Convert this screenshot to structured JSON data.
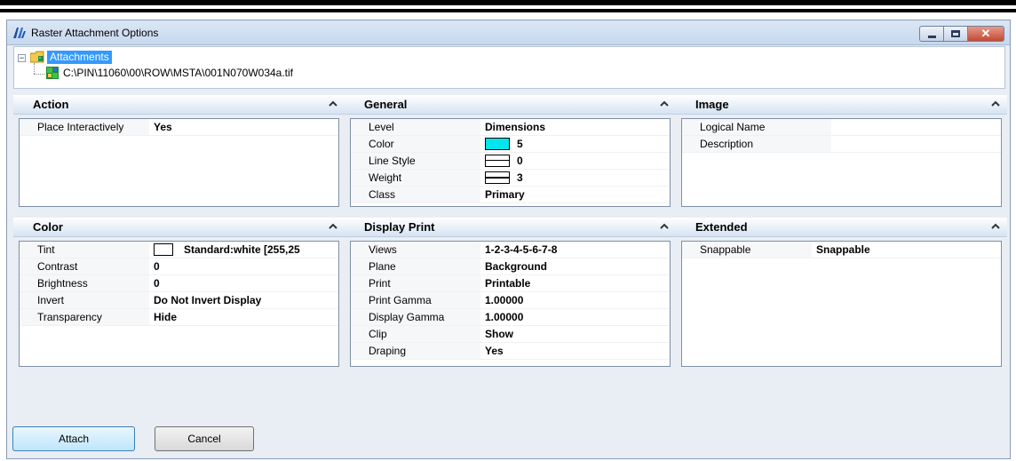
{
  "window": {
    "title": "Raster Attachment Options",
    "close_glyph": "✕"
  },
  "tree": {
    "expander_glyph": "−",
    "root_label": "Attachments",
    "file_path": "C:\\PIN\\11060\\00\\ROW\\MSTA\\001N070W034a.tif"
  },
  "panels": {
    "action": {
      "title": "Action",
      "props": [
        {
          "name": "Place Interactively",
          "value": "Yes"
        }
      ]
    },
    "general": {
      "title": "General",
      "props": [
        {
          "name": "Level",
          "value": "Dimensions"
        },
        {
          "name": "Color",
          "value": "5",
          "swatch": "#00e5ee"
        },
        {
          "name": "Line Style",
          "value": "0"
        },
        {
          "name": "Weight",
          "value": "3"
        },
        {
          "name": "Class",
          "value": "Primary"
        }
      ]
    },
    "image": {
      "title": "Image",
      "props": [
        {
          "name": "Logical Name",
          "value": ""
        },
        {
          "name": "Description",
          "value": ""
        }
      ]
    },
    "color": {
      "title": "Color",
      "props": [
        {
          "name": "Tint",
          "value": "Standard:white [255,25",
          "swatch": "#ffffff"
        },
        {
          "name": "Contrast",
          "value": "0"
        },
        {
          "name": "Brightness",
          "value": "0"
        },
        {
          "name": "Invert",
          "value": "Do Not Invert Display"
        },
        {
          "name": "Transparency",
          "value": "Hide"
        }
      ]
    },
    "display_print": {
      "title": "Display Print",
      "props": [
        {
          "name": "Views",
          "value": "1-2-3-4-5-6-7-8"
        },
        {
          "name": "Plane",
          "value": "Background"
        },
        {
          "name": "Print",
          "value": "Printable"
        },
        {
          "name": "Print Gamma",
          "value": "1.00000"
        },
        {
          "name": "Display Gamma",
          "value": "1.00000"
        },
        {
          "name": "Clip",
          "value": "Show"
        },
        {
          "name": "Draping",
          "value": "Yes"
        }
      ]
    },
    "extended": {
      "title": "Extended",
      "props": [
        {
          "name": "Snappable",
          "value": "Snappable"
        }
      ]
    }
  },
  "buttons": {
    "attach": "Attach",
    "cancel": "Cancel"
  },
  "colors": {
    "selection": "#3399ff",
    "panel_header": "#d6e3f3",
    "window_bg": "#e9eef5"
  }
}
